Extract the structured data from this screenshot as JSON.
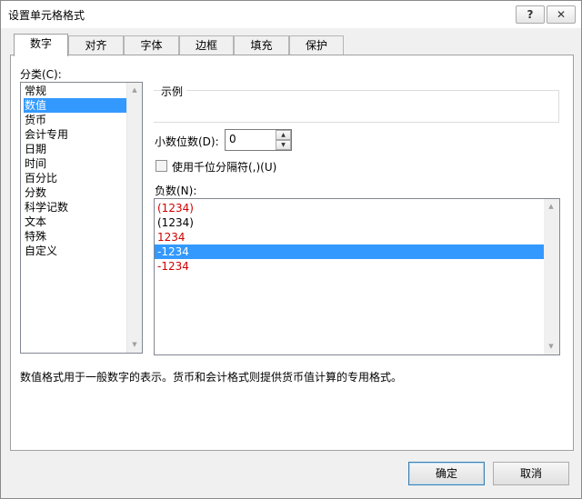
{
  "window": {
    "title": "设置单元格格式",
    "help_label": "?",
    "close_label": "✕"
  },
  "tabs": [
    {
      "label": "数字"
    },
    {
      "label": "对齐"
    },
    {
      "label": "字体"
    },
    {
      "label": "边框"
    },
    {
      "label": "填充"
    },
    {
      "label": "保护"
    }
  ],
  "category": {
    "label": "分类(C):",
    "items": [
      "常规",
      "数值",
      "货币",
      "会计专用",
      "日期",
      "时间",
      "百分比",
      "分数",
      "科学记数",
      "文本",
      "特殊",
      "自定义"
    ],
    "selected": "数值"
  },
  "sample": {
    "label": "示例",
    "value": ""
  },
  "decimal": {
    "label": "小数位数(D):",
    "value": "0"
  },
  "thousands": {
    "label": "使用千位分隔符(,)(U)",
    "checked": false
  },
  "negative": {
    "label": "负数(N):",
    "items": [
      {
        "text": "(1234)",
        "color": "#d00000"
      },
      {
        "text": "(1234)",
        "color": "#000000"
      },
      {
        "text": "1234",
        "color": "#d00000"
      },
      {
        "text": "-1234",
        "color": "#000000",
        "selected": true
      },
      {
        "text": "-1234",
        "color": "#d00000"
      }
    ]
  },
  "description": "数值格式用于一般数字的表示。货币和会计格式则提供货币值计算的专用格式。",
  "buttons": {
    "ok": "确定",
    "cancel": "取消"
  },
  "colors": {
    "selection": "#3399ff",
    "negative_red": "#d00000"
  }
}
